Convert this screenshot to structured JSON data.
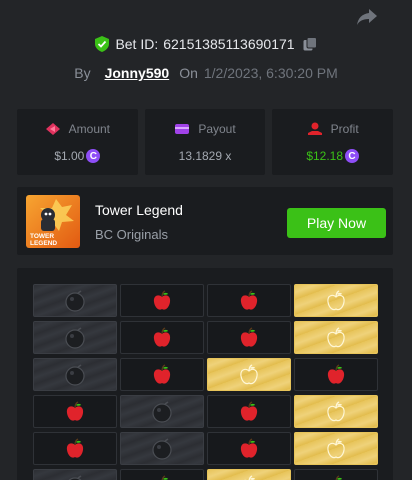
{
  "bet": {
    "id_label": "Bet ID:",
    "id_value": "62151385113690171",
    "by_label": "By",
    "username": "Jonny590",
    "on_label": "On",
    "date": "1/2/2023, 6:30:20 PM"
  },
  "stats": {
    "amount": {
      "label": "Amount",
      "value": "$1.00"
    },
    "payout": {
      "label": "Payout",
      "value": "13.1829 x"
    },
    "profit": {
      "label": "Profit",
      "value": "$12.18"
    }
  },
  "currency_symbol": "C",
  "game": {
    "name": "Tower Legend",
    "provider": "BC Originals",
    "play_label": "Play Now",
    "thumb_text": "TOWER LEGEND"
  },
  "colors": {
    "accent_green": "#3bc117",
    "coin_purple": "#8e4ef7",
    "apple_red": "#e0232b",
    "tile_gold": "#e7c45a"
  },
  "board": {
    "rows": [
      [
        "dark",
        "apple",
        "apple",
        "gold"
      ],
      [
        "dark",
        "apple",
        "apple",
        "gold"
      ],
      [
        "dark",
        "apple",
        "gold",
        "apple"
      ],
      [
        "apple",
        "dark",
        "apple",
        "gold"
      ],
      [
        "apple",
        "dark",
        "apple",
        "gold"
      ],
      [
        "dark",
        "apple",
        "gold",
        "apple"
      ]
    ]
  }
}
